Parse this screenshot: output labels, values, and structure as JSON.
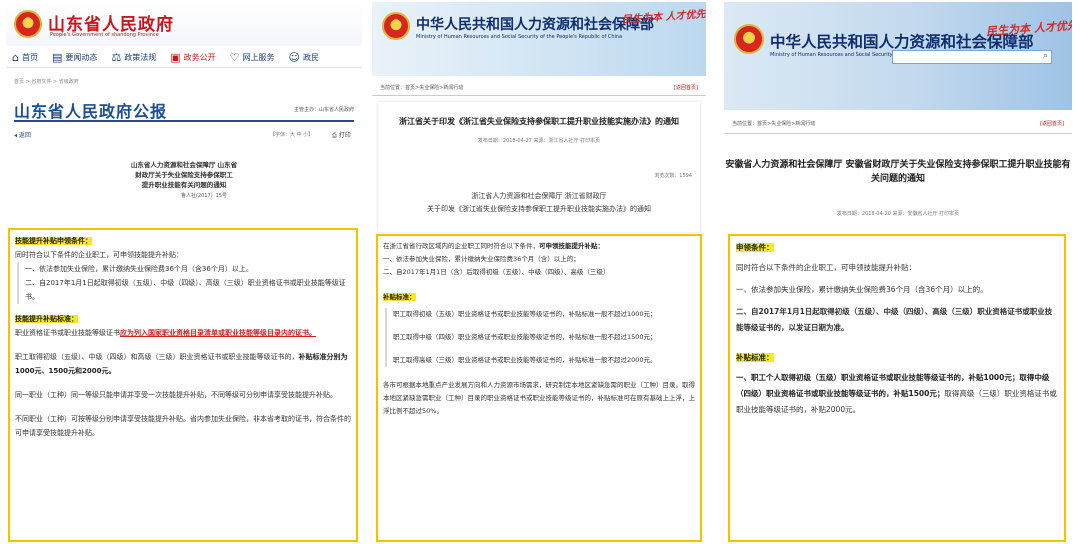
{
  "panel1": {
    "site_title": "山东省人民政府",
    "site_subtitle": "People's Government of shandong Province",
    "nav": [
      {
        "label": "首页",
        "icon": "home-icon"
      },
      {
        "label": "要闻动态",
        "icon": "news-icon"
      },
      {
        "label": "政策法规",
        "icon": "policy-icon"
      },
      {
        "label": "政务公开",
        "icon": "briefcase-icon"
      },
      {
        "label": "网上服务",
        "icon": "heart-icon"
      },
      {
        "label": "政民",
        "icon": "people-icon"
      }
    ],
    "breadcrumb": "首页 > 省府文件 > 省级政府",
    "section_title": "山东省人民政府公报",
    "sponsor": "主管主办：山东省人民政府",
    "back_label": "返回",
    "font_size_label": "【字体：大 中 小】",
    "print_label": "打印",
    "doc_title_lines": [
      "山东省人力资源和社会保障厅  山东省",
      "财政厅关于失业保险支持参保职工",
      "提升职业技能有关问题的通知"
    ],
    "doc_number": "鲁人社(2017）15号",
    "content": {
      "h1": "技能提升补贴申领条件：",
      "p1": "同时符合以下条件的企业职工，可申领技能提升补贴：",
      "i1": "一、依法参加失业保险，累计缴纳失业保险费36个月（含36个月）以上。",
      "i2": "二、自2017年1月1日起取得初级（五级）、中级（四级）、高级（三级）职业资格证书或职业技能等级证书。",
      "h2": "技能提升补贴标准：",
      "p2a": "职业资格证书或职业技能等级证书",
      "p2b": "应为列入国家职业资格目录清单或职业技能等级目录内的证书。",
      "p3a": "职工取得初级（五级）、中级（四级）和高级（三级）职业资格证书或职业技能等级证书的，",
      "p3b": "补贴标准分别为1000元、1500元和2000元。",
      "p4": "同一职业（工种）同一等级只能申请并享受一次技能提升补贴，不同等级可分别申请享受技能提升补贴。",
      "p5": "不同职业（工种）可按等级分别申请享受技能提升补贴。省内参加失业保险，非本省考取的证书，符合条件的可申请享受技能提升补贴。"
    }
  },
  "panel2": {
    "site_title": "中华人民共和国人力资源和社会保障部",
    "site_subtitle": "Ministry of Human Resources and Social Security of the People's Republic of China",
    "slogan": "民生为本 人才优先",
    "breadcrumb": "当前位置：首页>失业保险>新闻行动",
    "back_label": "[返回首页]",
    "doc_title": "浙江省关于印发《浙江省失业保险支持参保职工提升职业技能实施办法》的通知",
    "meta": "发布日期：2018-04-27      来源：浙江省人社厅      打印本页",
    "views": "浏览次数：1594",
    "issuer_lines": [
      "浙江省人力资源和社会保障厅  浙江省财政厅",
      "关于印发《浙江省失业保险支持参保职工提升职业技能实施办法》的通知"
    ],
    "content": {
      "p1a": "在浙江省省行政区域内的企业职工同时符合以下条件，",
      "p1b": "可申领技能提升补贴：",
      "i1": "一、依法参加失业保险，累计缴纳失业保险费36个月（含）以上的；",
      "i2": "二、自2017年1月1日（含）后取得初级（五级）、中级（四级）、高级（三级）",
      "h1": "补贴标准：",
      "s1": "职工取得初级（五级）职业资格证书或职业技能等级证书的，补贴标准一般不超过1000元；",
      "s2": "职工取得中级（四级）职业资格证书或职业技能等级证书的，补贴标准一般不超过1500元；",
      "s3": "职工取得高级（三级）职业资格证书或职业技能等级证书的，补贴标准一般不超过2000元。",
      "p2": "各市可根据本地重点产业发展方向和人力资源市场需求，研究制定本地区紧缺急需的职业（工种）目录。取得本地区紧缺急需职业（工种）目录的职业资格证书或职业技能等级证书的，补贴标准可在原有基础上上浮，上浮比例不超过50%。"
    }
  },
  "panel3": {
    "site_title": "中华人民共和国人力资源和社会保障部",
    "site_subtitle": "Ministry of Human Resources and Social Security of the People's Republic of China",
    "slogan": "民生为本 人才优先",
    "breadcrumb": "当前位置：首页>失业保险>新闻行动",
    "back_label": "[返回首页]",
    "doc_title_lines": [
      "安徽省人力资源和社会保障厅 安徽省财政厅关于失业保险支持参保职工提升职业技能有",
      "关问题的通知"
    ],
    "meta": "发布日期：2018-04-20      来源：安徽省人社厅      打印本页",
    "content": {
      "h1": "申领条件：",
      "p1": "同时符合以下条件的企业职工，可申领技能提升补贴：",
      "i1": "一、依法参加失业保险，累计缴纳失业保险费36个月（含36个月）以上的。",
      "i2": "二、自2017年1月1日起取得初级（五级）、中级（四级）、高级（三级）职业资格证书或职业技能等级证书的，以发证日期为准。",
      "h2": "补贴标准：",
      "p2a": "一、职工个人取得初级（五级）职业资格证书或职业技能等级证书的，补贴1000元；",
      "p2b": "取得中级（四级）职业资格证书或职业技能等级证书的，补贴1500元；",
      "p2c": "取得高级（三级）职业资格证书或职业技能等级证书的，补贴2000元。"
    }
  },
  "colors": {
    "highlight_border": "#f2c300",
    "highlight_fill": "#f8e72d",
    "gov_red": "#c8161d",
    "ministry_blue": "#0f2e6e"
  }
}
